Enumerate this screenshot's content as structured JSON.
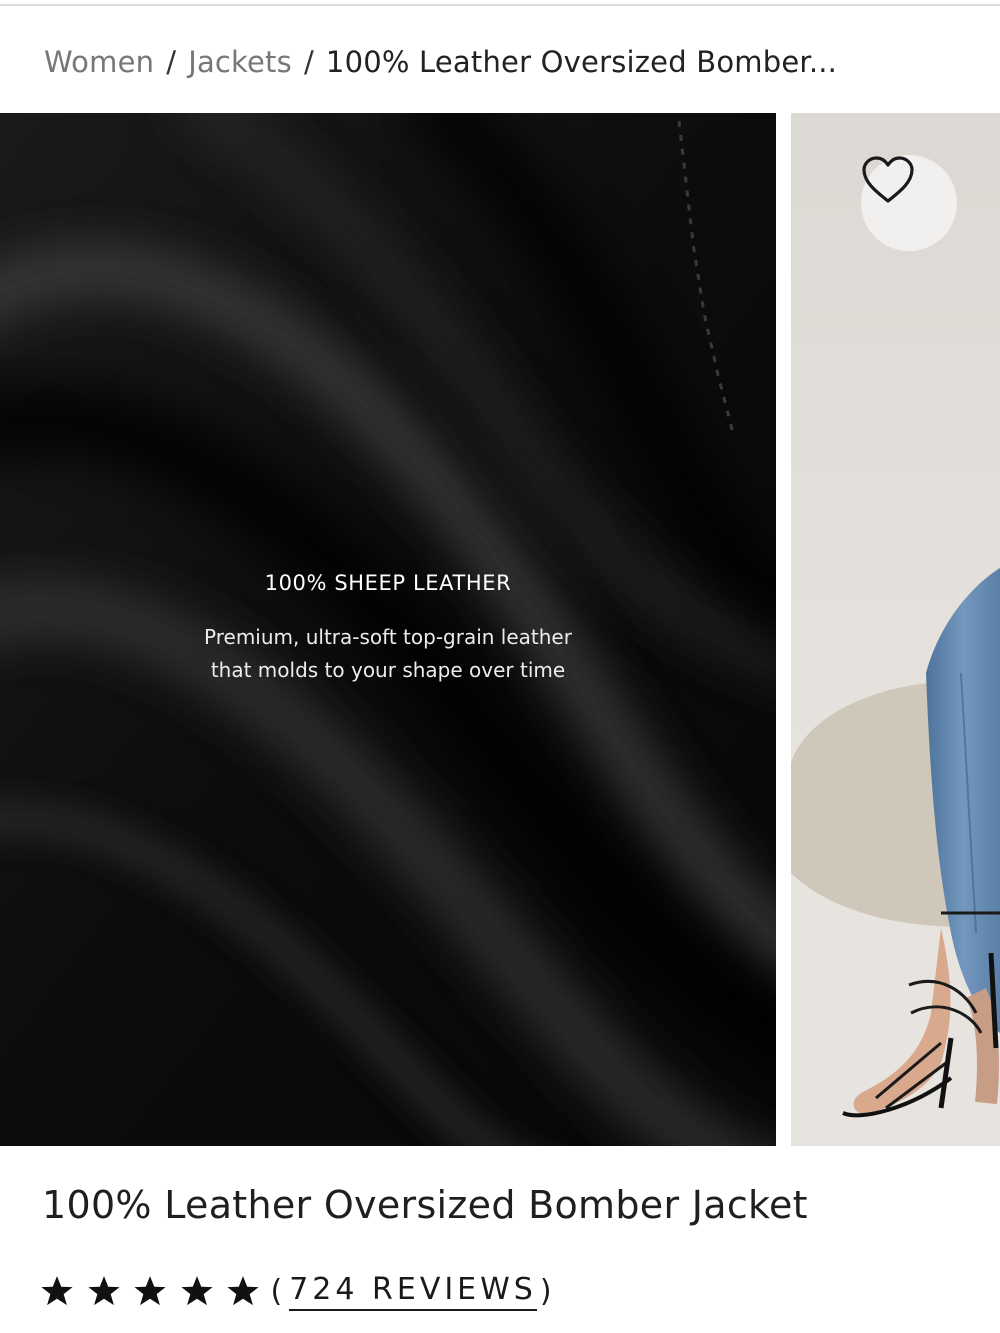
{
  "breadcrumb": {
    "items": [
      "Women",
      "Jackets"
    ],
    "separator": "/",
    "current": "100% Leather Oversized Bomber..."
  },
  "gallery": {
    "slides": [
      {
        "title": "100% SHEEP LEATHER",
        "text_line1": "Premium, ultra-soft top-grain leather",
        "text_line2": "that molds to your shape over time"
      },
      {}
    ],
    "wishlist_icon": "heart-outline-icon"
  },
  "product": {
    "title": "100% Leather Oversized Bomber Jacket",
    "rating": {
      "stars": 5,
      "paren_open": "(",
      "reviews_label": "724 REVIEWS",
      "paren_close": ")"
    }
  },
  "colors": {
    "text": "#1a1a1a",
    "muted_link": "#777777",
    "leather": "#0b0b0b",
    "backdrop": "#e6e3df",
    "denim": "#5f84ab"
  }
}
